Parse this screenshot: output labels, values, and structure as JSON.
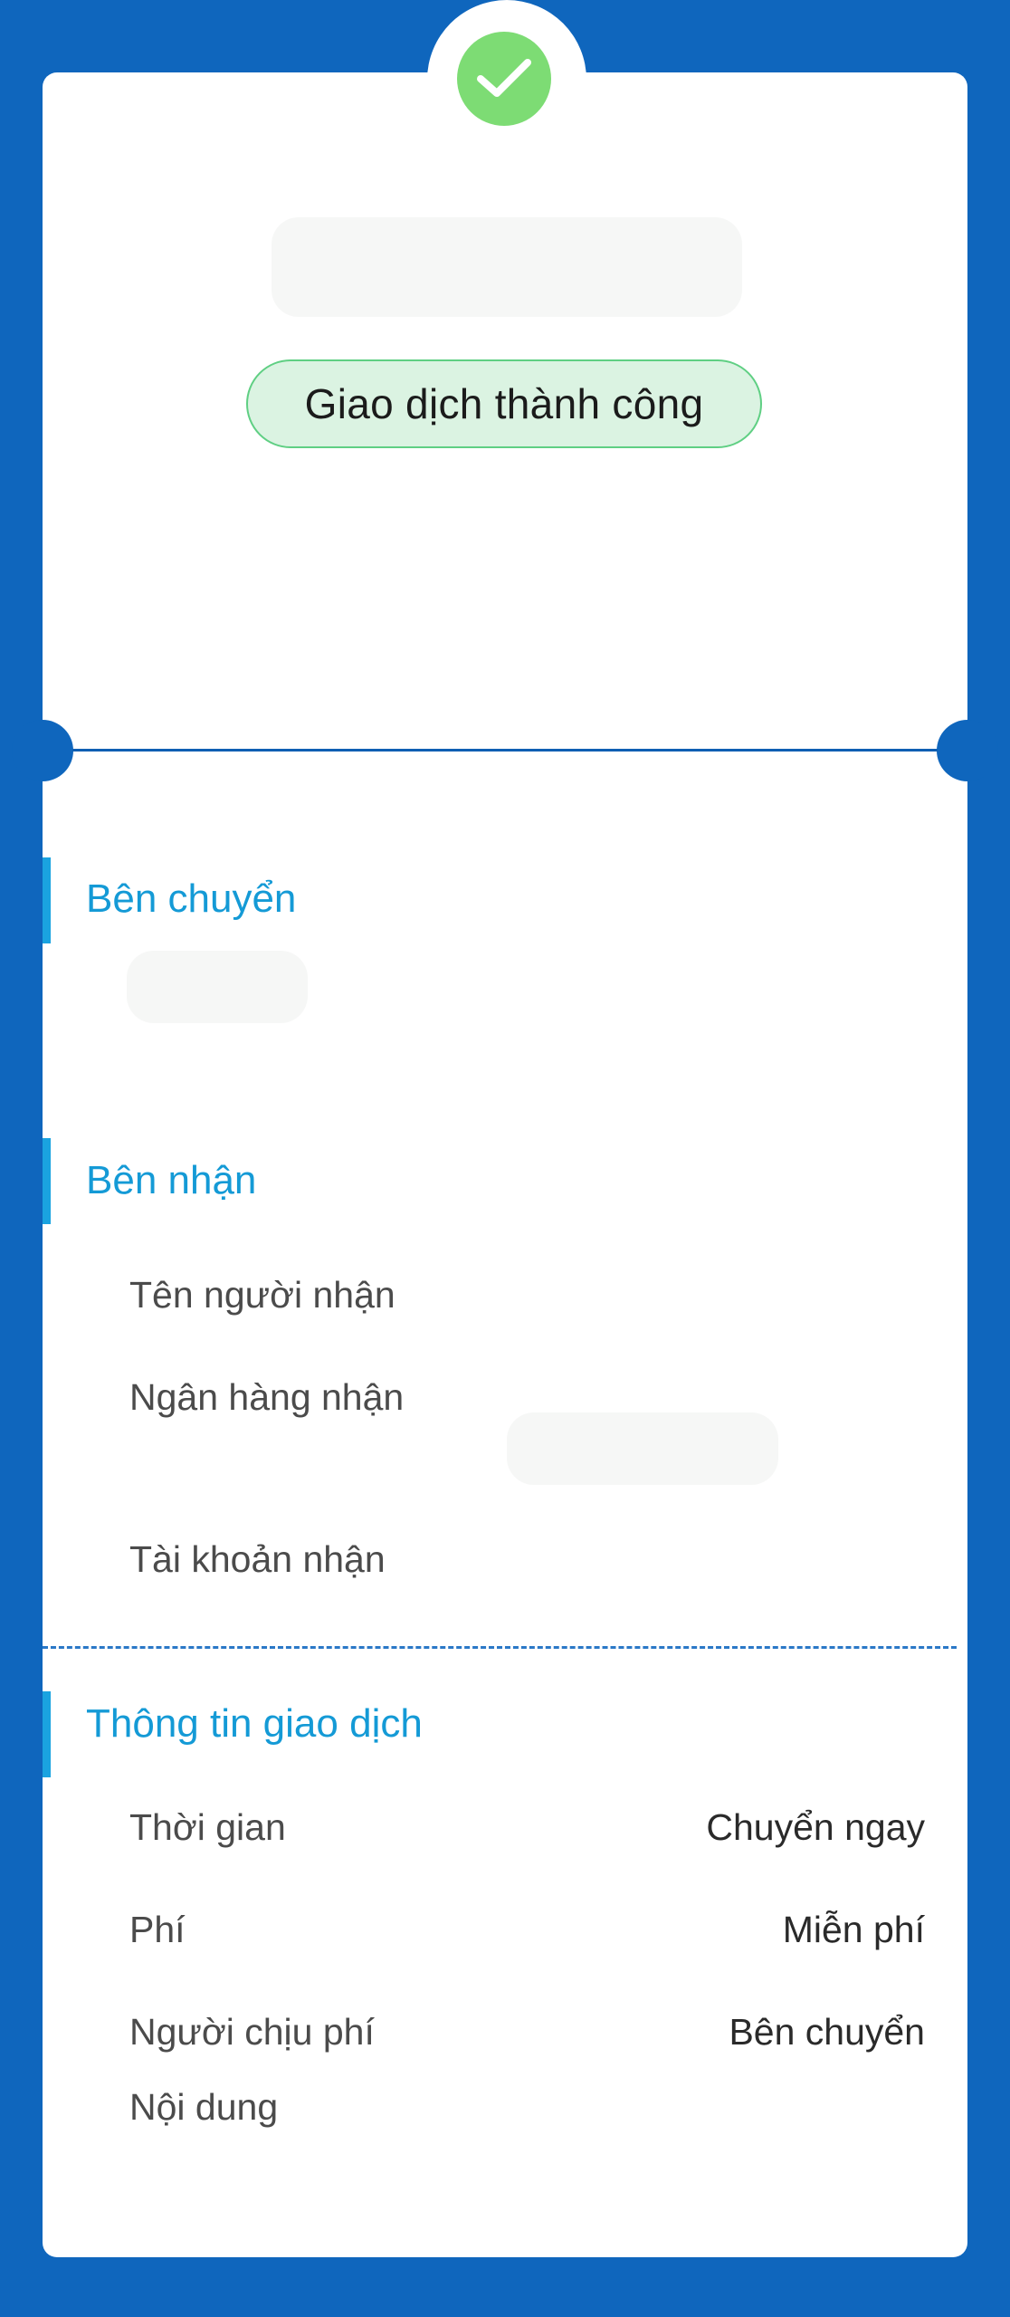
{
  "status": {
    "label": "Giao dịch thành công",
    "icon": "check-icon",
    "accent_color": "#7ddc74"
  },
  "sender_section": {
    "title": "Bên chuyển"
  },
  "receiver_section": {
    "title": "Bên nhận",
    "fields": [
      {
        "label": "Tên người nhận"
      },
      {
        "label": "Ngân hàng nhận"
      },
      {
        "label": "Tài khoản nhận"
      }
    ]
  },
  "transaction_section": {
    "title": "Thông tin giao dịch",
    "fields": [
      {
        "label": "Thời gian",
        "value": "Chuyển ngay"
      },
      {
        "label": "Phí",
        "value": "Miễn phí"
      },
      {
        "label": "Người chịu phí",
        "value": "Bên chuyển"
      },
      {
        "label": "Nội dung",
        "value": ""
      }
    ]
  },
  "colors": {
    "background": "#0f66bd",
    "section_title": "#149ad6",
    "pill_border": "#5fcf83",
    "pill_fill": "#dbf3e2"
  }
}
